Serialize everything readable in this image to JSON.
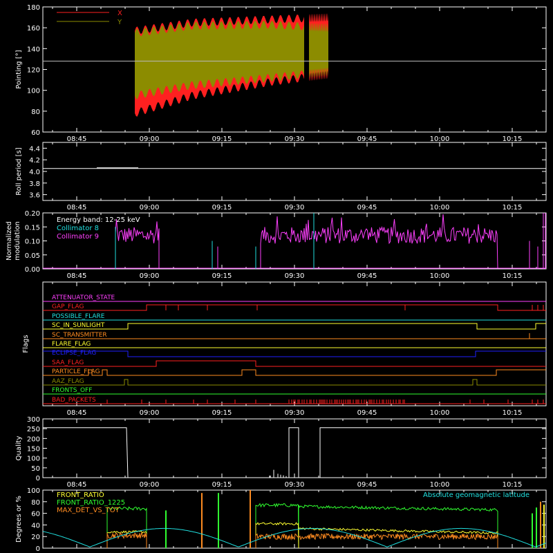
{
  "colors": {
    "background": "#000000",
    "axis": "#ffffff",
    "x": "#ff2020",
    "y": "#8c8c00",
    "collimator8": "#20e0e0",
    "collimator9": "#ff40ff",
    "front_ratio": "#ffff30",
    "front_ratio_1225": "#30ff30",
    "max_det": "#ff8c20",
    "geomag": "#20e0e0"
  },
  "time_axis": {
    "start": "08:38",
    "end": "10:22",
    "tick_labels": [
      "08:45",
      "09:00",
      "09:15",
      "09:30",
      "09:45",
      "10:00",
      "10:15"
    ]
  },
  "chart_data": [
    {
      "type": "area",
      "ylabel": "Pointing [°]",
      "ylim": [
        60,
        180
      ],
      "yticks": [
        "60",
        "80",
        "100",
        "120",
        "140",
        "160",
        "180"
      ],
      "reference_line": 128,
      "legend": [
        "X",
        "Y"
      ],
      "segments": [
        {
          "start": "08:57",
          "end": "09:32"
        },
        {
          "start": "09:33",
          "end": "09:37"
        }
      ],
      "series": [
        {
          "name": "X",
          "upper": [
            [
              0,
              157
            ],
            [
              0.3,
              165
            ],
            [
              0.7,
              168
            ],
            [
              1.0,
              170
            ]
          ],
          "lower": [
            [
              0,
              78
            ],
            [
              0.3,
              95
            ],
            [
              0.7,
              108
            ],
            [
              1.0,
              115
            ]
          ]
        },
        {
          "name": "Y",
          "upper": [
            [
              0,
              155
            ],
            [
              0.3,
              162
            ],
            [
              0.7,
              163
            ],
            [
              1.0,
              160
            ]
          ],
          "lower": [
            [
              0,
              95
            ],
            [
              0.3,
              105
            ],
            [
              0.7,
              112
            ],
            [
              1.0,
              118
            ]
          ]
        }
      ]
    },
    {
      "type": "line",
      "ylabel": "Roll period [s]",
      "ylim": [
        3.5,
        4.5
      ],
      "yticks": [
        "3.6",
        "3.8",
        "4.0",
        "4.2",
        "4.4"
      ],
      "value": 4.05
    },
    {
      "type": "line",
      "ylabel": "Normalized modulation",
      "ylim": [
        0,
        0.2
      ],
      "yticks": [
        "0.00",
        "0.05",
        "0.10",
        "0.15",
        "0.20"
      ],
      "legend": [
        "Energy band: 12-25 keV",
        "Collimator 8",
        "Collimator 9"
      ],
      "series": [
        {
          "name": "Collimator 9",
          "segments": [
            {
              "start": "08:53",
              "end": "09:02",
              "level": 0.12
            },
            {
              "start": "09:23",
              "end": "10:12",
              "level": 0.12
            }
          ]
        },
        {
          "name": "Collimator 8",
          "spikes": [
            {
              "t": "08:53",
              "v": 0.15
            },
            {
              "t": "09:13",
              "v": 0.1
            },
            {
              "t": "09:22",
              "v": 0.08
            },
            {
              "t": "09:34",
              "v": 0.2
            }
          ]
        }
      ]
    },
    {
      "type": "table",
      "ylabel": "Flags",
      "flags": [
        {
          "name": "ATTENUATOR_STATE",
          "color": "#ff40ff"
        },
        {
          "name": "GAP_FLAG",
          "color": "#ff2020"
        },
        {
          "name": "POSSIBLE_FLARE",
          "color": "#20e0e0"
        },
        {
          "name": "SC_IN_SUNLIGHT",
          "color": "#ffff30"
        },
        {
          "name": "SC_TRANSMITTER",
          "color": "#ff8c20"
        },
        {
          "name": "FLARE_FLAG",
          "color": "#ffff30"
        },
        {
          "name": "ECLIPSE_FLAG",
          "color": "#2020ff"
        },
        {
          "name": "SAA_FLAG",
          "color": "#ff2020"
        },
        {
          "name": "PARTICLE_FLAG",
          "color": "#ff8c20"
        },
        {
          "name": "AAZ_FLAG",
          "color": "#8c8c00"
        },
        {
          "name": "FRONTS_OFF",
          "color": "#30ff30"
        },
        {
          "name": "BAD_PACKETS",
          "color": "#ff2020"
        }
      ]
    },
    {
      "type": "line",
      "ylabel": "Quality",
      "ylim": [
        0,
        300
      ],
      "yticks": [
        "0",
        "50",
        "100",
        "150",
        "200",
        "250",
        "300"
      ]
    },
    {
      "type": "line",
      "ylabel": "Degrees or %",
      "ylim": [
        0,
        100
      ],
      "yticks": [
        "0",
        "20",
        "40",
        "60",
        "80",
        "100"
      ],
      "legend": [
        "FRONT_RATIO",
        "FRONT_RATIO_1225",
        "MAX_DET_VS_TOT"
      ],
      "right_legend": "Absolute geomagnetic latitude"
    }
  ]
}
